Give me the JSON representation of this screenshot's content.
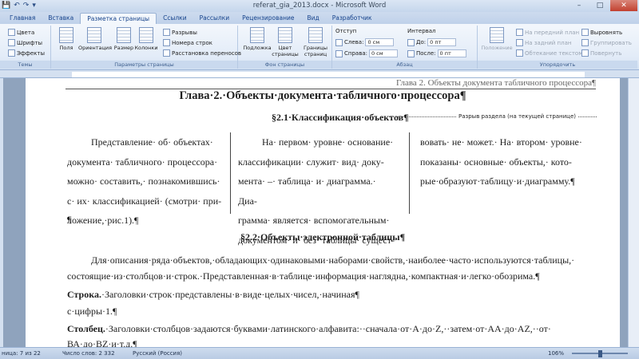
{
  "window": {
    "title": "referat_gia_2013.docx - Microsoft Word",
    "controls": {
      "minimize": "–",
      "maximize": "□",
      "close": "✕"
    }
  },
  "qat": {
    "save": "💾",
    "undo": "↶",
    "redo": "↷",
    "more": "▾"
  },
  "tabs": [
    "Главная",
    "Вставка",
    "Разметка страницы",
    "Ссылки",
    "Рассылки",
    "Рецензирование",
    "Вид",
    "Разработчик"
  ],
  "active_tab": "Разметка страницы",
  "ribbon": {
    "themes": {
      "colors": "Цвета",
      "fonts": "Шрифты",
      "effects": "Эффекты",
      "label": "Темы"
    },
    "page_setup": {
      "margins": "Поля",
      "orientation": "Ориентация",
      "size": "Размер",
      "columns": "Колонки",
      "breaks": "Разрывы",
      "line_numbers": "Номера строк",
      "hyphenation": "Расстановка переносов",
      "label": "Параметры страницы"
    },
    "page_background": {
      "watermark": "Подложка",
      "color": "Цвет страницы",
      "borders": "Границы страниц",
      "label": "Фон страницы"
    },
    "paragraph": {
      "indent": "Отступ",
      "left_label": "Слева:",
      "left_value": "0 см",
      "right_label": "Справа:",
      "right_value": "0 см",
      "spacing": "Интервал",
      "before_label": "До:",
      "before_value": "0 пт",
      "after_label": "После:",
      "after_value": "0 пт",
      "label": "Абзац"
    },
    "arrange": {
      "position": "Положение",
      "bring_front": "На передний план",
      "send_back": "На задний план",
      "text_wrap": "Обтекание текстом",
      "align": "Выровнять",
      "group": "Группировать",
      "rotate": "Повернуть",
      "label": "Упорядочить"
    }
  },
  "document": {
    "running_header": "Глава 2. Объекты документа табличного процессора¶",
    "chapter_title": "Глава·2.·Объекты·документа·табличного·процессора¶",
    "section1": "§2.1·Классификация·объектов¶",
    "section_break": "Разрыв раздела (на текущей странице)",
    "col1": [
      "Представление· об· объектах·",
      "документа· табличного· процессора·",
      "можно· составить,· познакомившись·",
      "с· их· классификацией· (смотри· при-",
      "ложение,·рис.1).¶"
    ],
    "col2": [
      "На· первом· уровне· основание·",
      "классификации· служит· вид· доку-",
      "мента· –· таблица· и· диаграмма.· Диа-",
      "грамма· является· вспомогательным·",
      "документом· и· без· таблицы· сущест-"
    ],
    "col3": [
      "вовать· не· может.· На· втором· уровне·",
      "показаны· основные· объекты,· кото-",
      "рые·образуют·таблицу·и·диаграмму.¶"
    ],
    "empty_para": "¶",
    "section2": "§2.2·Объекты·электронной·таблицы¶",
    "para1_line1": "Для·описания·ряда·объектов,·обладающих·одинаковыми·наборами·свойств,·наиболее·часто·используются·таблицы,·",
    "para1_line2": "состоящие·из·столбцов·и·строк.·Представленная·в·таблице·информация·наглядна,·компактная·и·легко·обозрима.¶",
    "para2_bold": "Строка.",
    "para2_rest": "·Заголовки·строк·представлены·в·виде·целых·чисел,·начиная¶",
    "para3": "с·цифры·1.¶",
    "para4_bold": "Столбец.",
    "para4_rest": "·Заголовки·столбцов·задаются·буквами·латинского·алфавита:··сначала·от·А·до·Z,··затем·от·АА·до·AZ,··от·",
    "para5": "ВА·до·BZ·и·т.д.¶"
  },
  "status": {
    "page": "ница: 7 из 22",
    "words": "Число слов: 2 332",
    "language": "Русский (Россия)",
    "zoom": "106%"
  }
}
